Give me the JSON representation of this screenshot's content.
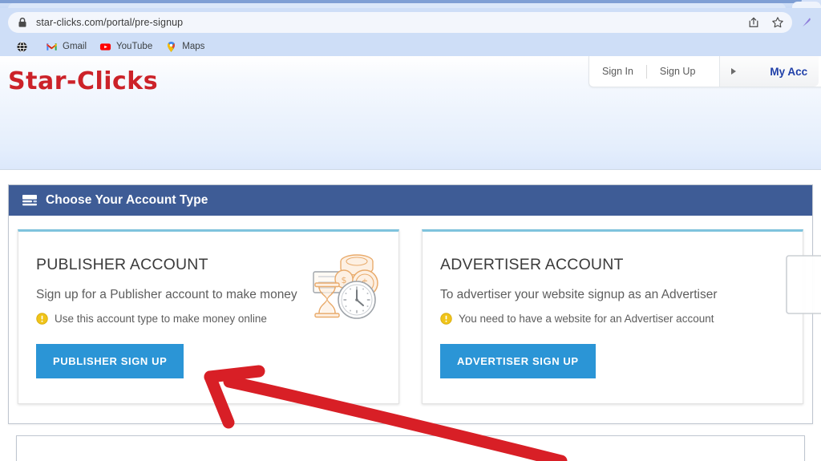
{
  "browser": {
    "url": "star-clicks.com/portal/pre-signup",
    "lock_icon": "lock-icon",
    "share_icon": "share-icon",
    "bookmark_icon": "star-icon",
    "pen_icon": "pen-icon",
    "bookmarks": [
      {
        "label": "",
        "icon": "globe-icon"
      },
      {
        "label": "Gmail",
        "icon": "gmail-icon"
      },
      {
        "label": "YouTube",
        "icon": "youtube-icon"
      },
      {
        "label": "Maps",
        "icon": "maps-icon"
      }
    ]
  },
  "site": {
    "logo": "Star-Clicks",
    "brand_red": "#cc2229",
    "account_bar": {
      "sign_in": "Sign In",
      "sign_up": "Sign Up",
      "caret_icon": "caret-right-icon",
      "my_account": "My Acc"
    }
  },
  "panel": {
    "header": {
      "icon": "account-card-icon",
      "title": "Choose Your Account Type",
      "bg": "#3e5c96"
    },
    "cards": [
      {
        "title": "PUBLISHER ACCOUNT",
        "subtitle": "Sign up for a Publisher account to make money",
        "note": "Use this account type to make money online",
        "note_icon": "warning-icon",
        "button": "PUBLISHER SIGN UP",
        "button_color": "#2b95d6",
        "art_icon": "time-is-money-icon"
      },
      {
        "title": "ADVERTISER ACCOUNT",
        "subtitle": "To advertiser your website signup as an Advertiser",
        "note": "You need to have a website for an Advertiser account",
        "note_icon": "warning-icon",
        "button": "ADVERTISER SIGN UP",
        "button_color": "#2b95d6",
        "art_icon": "advertiser-art-icon"
      }
    ]
  },
  "annotation": {
    "arrow_color": "#d81f26",
    "arrow_icon": "red-curved-arrow-icon"
  }
}
